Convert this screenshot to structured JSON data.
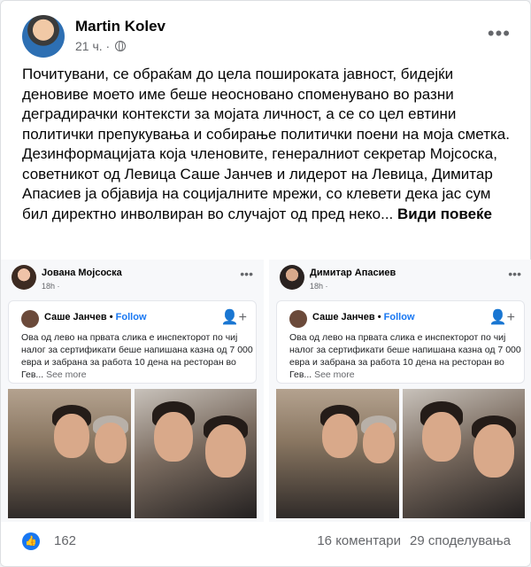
{
  "post": {
    "author": "Martin Kolev",
    "time": "21 ч. ·",
    "text": "Почитувани, се обраќам до цела пошироката јавност, бидејќи деновиве моето име  беше неосновано споменувано во разни деградирачки контексти за мојата личност, а се со цел евтини политички препукувања и собирање политички поени на моја сметка. Дезинформацијата која членовите, генералниот секретар Мојсоска, советникот од Левица Саше Јанчев и лидерот на Левица, Димитар Апасиев ја објавија на социјалните мрежи, со клевети дека јас сум бил директно инволвиран во случајот од пред неко...",
    "see_more": "Види повеќе"
  },
  "shots": [
    {
      "name": "Јована Мојсоска",
      "time": "18h ·",
      "inner_name": "Саше Јанчев",
      "follow": "Follow",
      "inner_text": "Ова од лево на првата слика е инспекторот по чиј налог за сертификати беше напишана казна од 7 000 евра и забрана за работа 10 дена на ресторан во Гев...",
      "inner_more": "See more"
    },
    {
      "name": "Димитар Апасиев",
      "time": "18h ·",
      "inner_name": "Саше Јанчев",
      "follow": "Follow",
      "inner_text": "Ова од лево на првата слика е инспекторот по чиј налог за сертификати беше напишана казна од 7 000 евра и забрана за работа 10 дена на ресторан во Гев...",
      "inner_more": "See more"
    }
  ],
  "reactions": {
    "likes": "162",
    "comments": "16 коментари",
    "shares": "29 споделувања"
  },
  "colors": {
    "accent": "#1877f2",
    "secondary_text": "#65676b"
  }
}
